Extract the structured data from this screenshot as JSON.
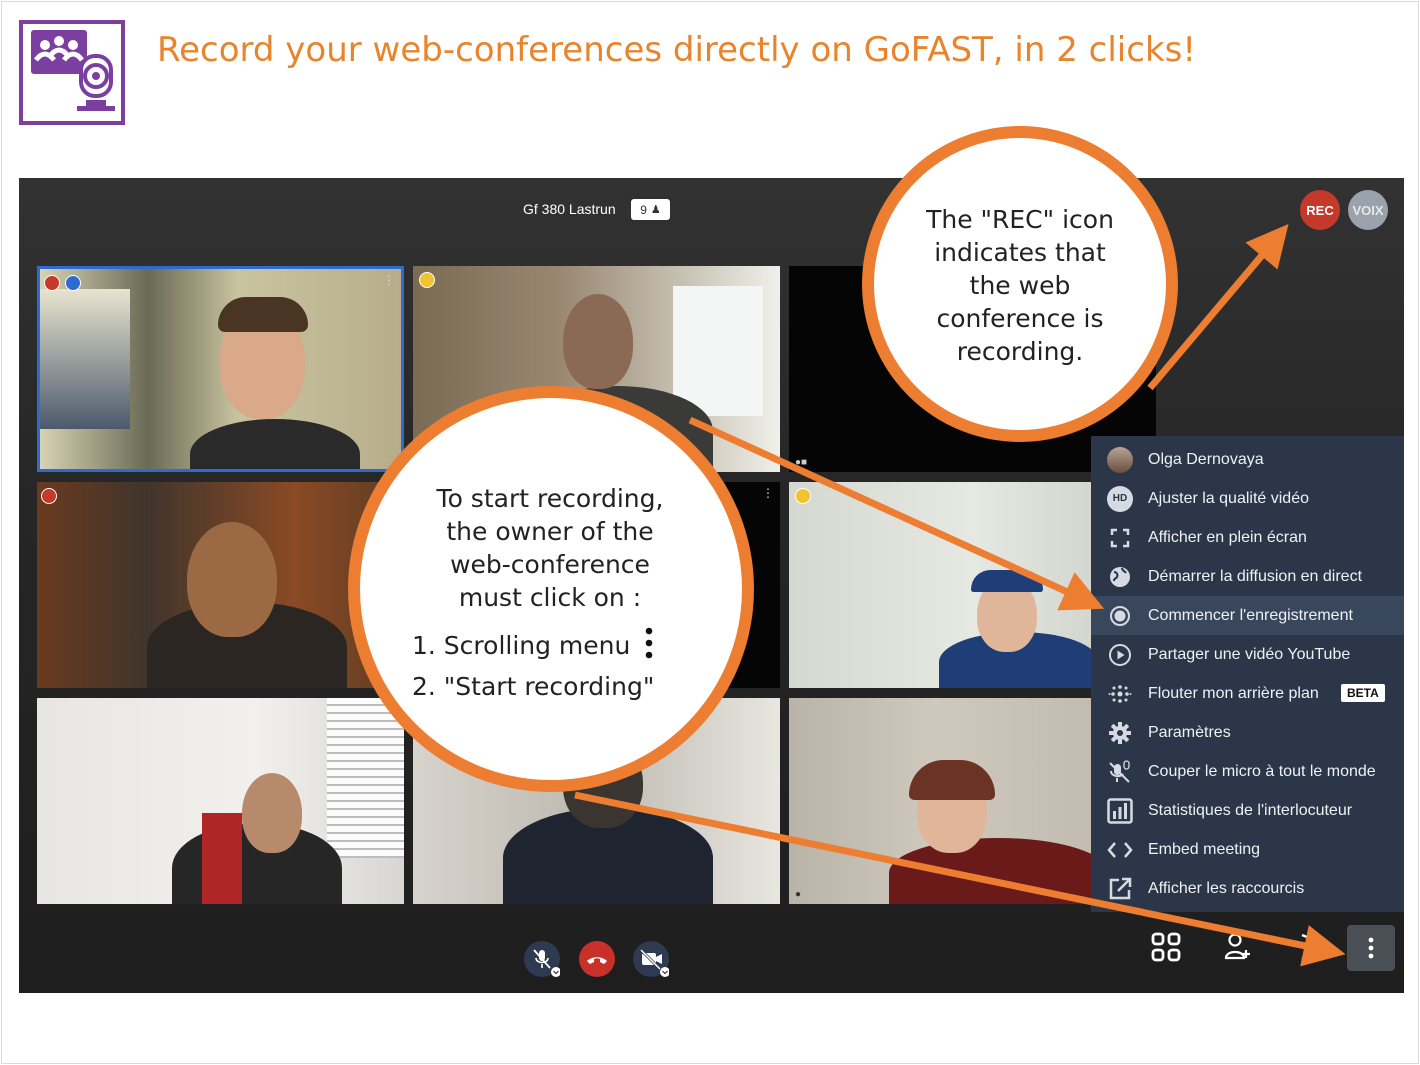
{
  "headline": "Record your web-conferences directly on GoFAST, in 2 clicks!",
  "conference": {
    "title": "Gf 380 Lastrun",
    "participant_count": "9",
    "rec_label": "REC",
    "voix_label": "VOIX"
  },
  "menu": {
    "items": [
      {
        "icon": "avatar-icon",
        "label": "Olga Dernovaya"
      },
      {
        "icon": "hd-icon",
        "label": "Ajuster la qualité vidéo"
      },
      {
        "icon": "fullscreen-icon",
        "label": "Afficher en plein écran"
      },
      {
        "icon": "globe-icon",
        "label": "Démarrer la diffusion en direct"
      },
      {
        "icon": "record-icon",
        "label": "Commencer l'enregistrement"
      },
      {
        "icon": "play-circle-icon",
        "label": "Partager une vidéo YouTube"
      },
      {
        "icon": "blur-icon",
        "label": "Flouter mon arrière plan",
        "badge": "BETA"
      },
      {
        "icon": "gear-icon",
        "label": "Paramètres"
      },
      {
        "icon": "mute-all-icon",
        "label": "Couper le micro à tout le monde"
      },
      {
        "icon": "stats-icon",
        "label": "Statistiques de l'interlocuteur"
      },
      {
        "icon": "embed-icon",
        "label": "Embed meeting"
      },
      {
        "icon": "external-link-icon",
        "label": "Afficher les raccourcis"
      }
    ],
    "hd_text": "HD"
  },
  "callouts": {
    "rec": [
      "The \"REC\" icon",
      "indicates that",
      "the web",
      "conference is",
      "recording."
    ],
    "start": [
      "To start recording,",
      "the owner of the",
      "web-conference",
      "must click on :"
    ],
    "step1": "1. Scrolling menu",
    "step2": "2. \"Start recording\""
  },
  "colors": {
    "accent_orange": "#ec7d31",
    "logo_purple": "#7b3fa0",
    "rec_red": "#c4392a",
    "menu_bg": "#2b3648"
  }
}
